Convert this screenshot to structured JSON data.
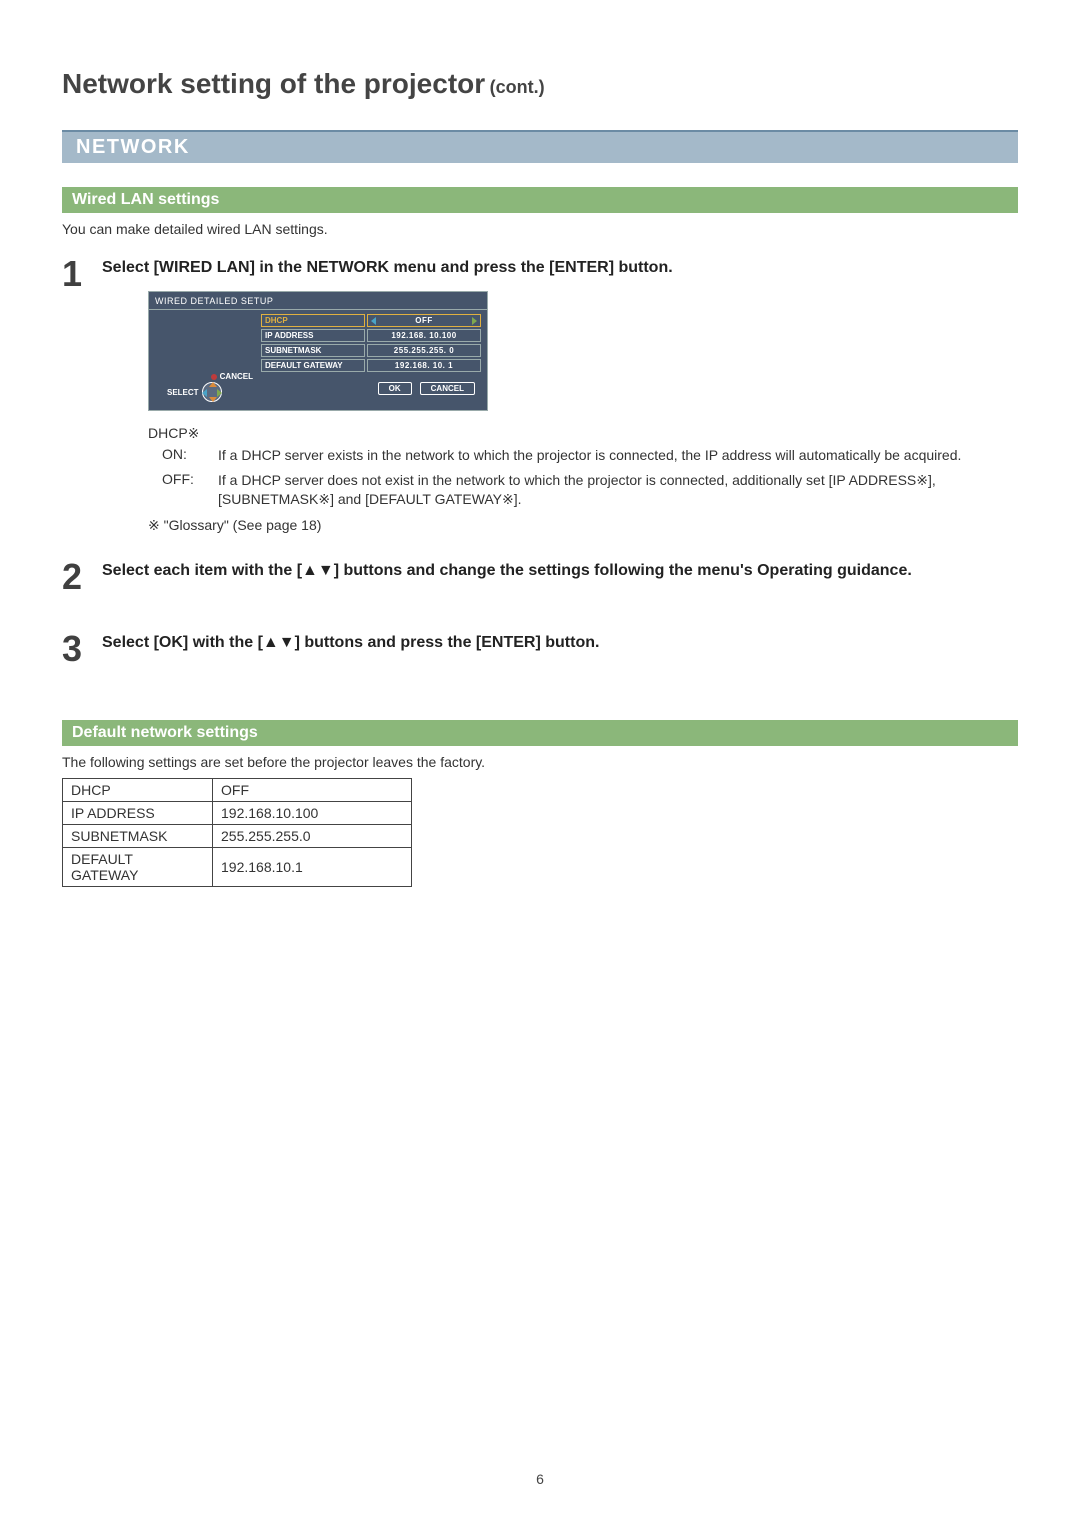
{
  "page": {
    "title_main": "Network setting of the projector",
    "title_cont": "(cont.)",
    "number": "6"
  },
  "section_bar": "NETWORK",
  "wired_lan": {
    "heading": "Wired LAN settings",
    "intro": "You can make detailed wired LAN settings.",
    "step1": {
      "num": "1",
      "title": "Select [WIRED LAN] in the NETWORK menu and press the [ENTER] button."
    },
    "osd": {
      "title": "WIRED DETAILED SETUP",
      "cancel": "CANCEL",
      "select": "SELECT",
      "rows": [
        {
          "label": "DHCP",
          "value": "OFF"
        },
        {
          "label": "IP ADDRESS",
          "value": "192.168. 10.100"
        },
        {
          "label": "SUBNETMASK",
          "value": "255.255.255.   0"
        },
        {
          "label": "DEFAULT GATEWAY",
          "value": "192.168. 10.   1"
        }
      ],
      "ok": "OK",
      "cancel_btn": "CANCEL"
    },
    "dhcp_heading": "DHCP※",
    "dhcp_on_label": "ON:",
    "dhcp_on_text": "If a DHCP server exists in the network to which the projector is connected, the IP address will automatically be acquired.",
    "dhcp_off_label": "OFF:",
    "dhcp_off_text": "If a DHCP server does not exist in the network to which the projector is connected, additionally set [IP ADDRESS※], [SUBNETMASK※] and [DEFAULT GATEWAY※].",
    "glossary": "※ \"Glossary\" (See page 18)",
    "step2": {
      "num": "2",
      "title": "Select each item with the [▲▼] buttons and change the settings following the menu's Operating guidance."
    },
    "step3": {
      "num": "3",
      "title": "Select [OK] with the [▲▼] buttons and press the [ENTER] button."
    }
  },
  "defaults": {
    "heading": "Default network settings",
    "intro": "The following settings are set before the projector leaves the factory.",
    "rows": [
      {
        "label": "DHCP",
        "value": "OFF"
      },
      {
        "label": "IP ADDRESS",
        "value": "192.168.10.100"
      },
      {
        "label": "SUBNETMASK",
        "value": "255.255.255.0"
      },
      {
        "label": "DEFAULT GATEWAY",
        "value": "192.168.10.1"
      }
    ]
  }
}
